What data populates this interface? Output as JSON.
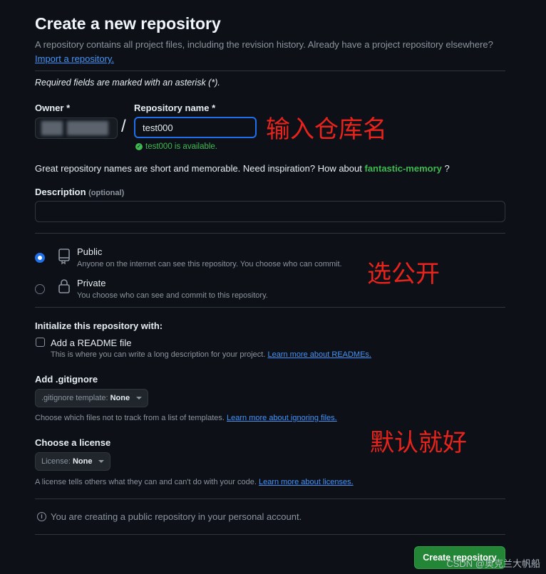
{
  "page": {
    "title": "Create a new repository",
    "intro_text": "A repository contains all project files, including the revision history. Already have a project repository elsewhere?",
    "import_link": "Import a repository.",
    "required_note": "Required fields are marked with an asterisk (*)."
  },
  "owner": {
    "label": "Owner *",
    "value": ""
  },
  "separator": "/",
  "repo_name": {
    "label": "Repository name *",
    "value": "test000",
    "availability": "test000 is available."
  },
  "hint": {
    "prefix": "Great repository names are short and memorable. Need inspiration? How about",
    "suggestion": "fantastic-memory",
    "suffix": "?"
  },
  "description": {
    "label": "Description",
    "optional": "(optional)",
    "value": ""
  },
  "visibility": {
    "public": {
      "title": "Public",
      "desc": "Anyone on the internet can see this repository. You choose who can commit.",
      "selected": true,
      "icon": "repo-icon"
    },
    "private": {
      "title": "Private",
      "desc": "You choose who can see and commit to this repository.",
      "selected": false,
      "icon": "lock-icon"
    }
  },
  "init": {
    "heading": "Initialize this repository with:",
    "readme_label": "Add a README file",
    "readme_desc": "This is where you can write a long description for your project.",
    "readme_link": "Learn more about READMEs.",
    "readme_checked": false
  },
  "gitignore": {
    "heading": "Add .gitignore",
    "prefix": ".gitignore template:",
    "value": "None",
    "desc": "Choose which files not to track from a list of templates.",
    "link": "Learn more about ignoring files."
  },
  "license": {
    "heading": "Choose a license",
    "prefix": "License:",
    "value": "None",
    "desc": "A license tells others what they can and can't do with your code.",
    "link": "Learn more about licenses."
  },
  "info_note": "You are creating a public repository in your personal account.",
  "create_button": "Create repository",
  "annotations": {
    "name": "输入仓库名",
    "public": "选公开",
    "defaults": "默认就好"
  },
  "watermark": "CSDN @奥克兰大帆船",
  "colors": {
    "accent": "#1f6feb",
    "success": "#3fb950",
    "button": "#238636",
    "annotation": "#e8231c",
    "background": "#0d1117"
  }
}
